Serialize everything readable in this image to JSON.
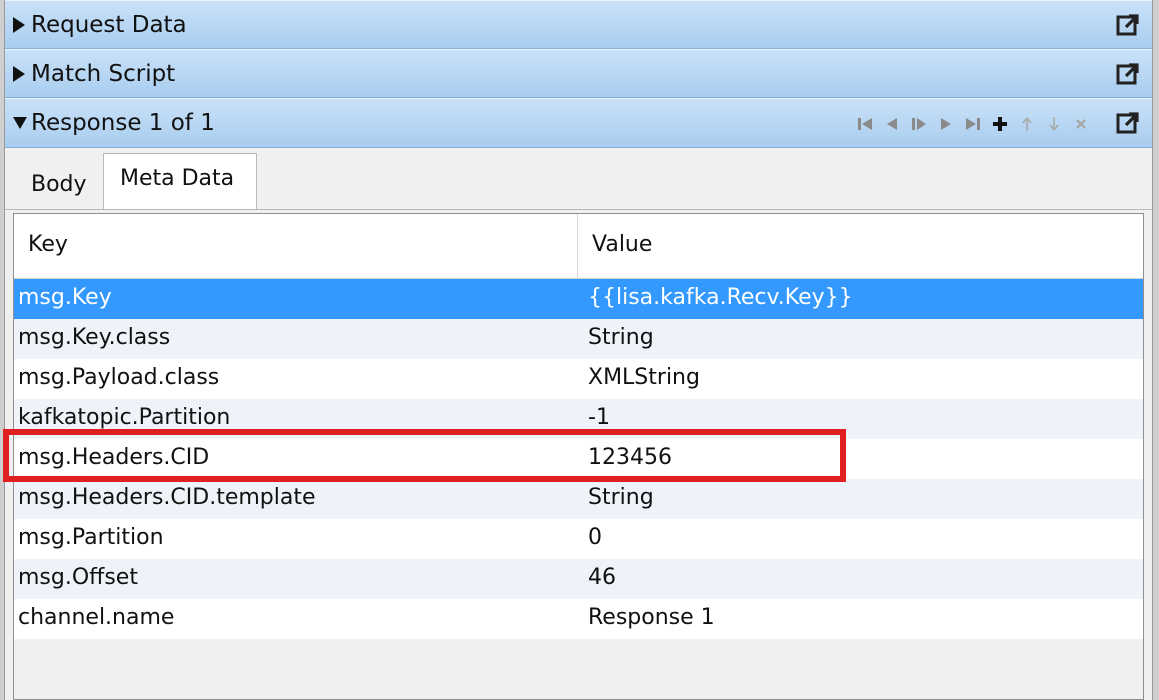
{
  "sections": {
    "request_data": {
      "label": "Request Data"
    },
    "match_script": {
      "label": "Match Script"
    },
    "response": {
      "label": "Response 1 of 1"
    }
  },
  "tabs": [
    {
      "label": "Body",
      "selected": false
    },
    {
      "label": "Meta Data",
      "selected": true
    }
  ],
  "table": {
    "columns": {
      "key": "Key",
      "value": "Value"
    },
    "rows": [
      {
        "key": "msg.Key",
        "value": "{{lisa.kafka.Recv.Key}}",
        "selected": true
      },
      {
        "key": "msg.Key.class",
        "value": "String"
      },
      {
        "key": "msg.Payload.class",
        "value": "XMLString"
      },
      {
        "key": "kafkatopic.Partition",
        "value": "-1"
      },
      {
        "key": "msg.Headers.CID",
        "value": "123456",
        "highlighted": true
      },
      {
        "key": "msg.Headers.CID.template",
        "value": "String"
      },
      {
        "key": "msg.Partition",
        "value": "0"
      },
      {
        "key": "msg.Offset",
        "value": "46"
      },
      {
        "key": "channel.name",
        "value": "Response 1"
      }
    ]
  },
  "icons": {
    "popout": "popout-icon",
    "nav": [
      "first-icon",
      "previous-icon",
      "play-icon",
      "next-icon",
      "last-icon",
      "add-icon",
      "move-up-icon",
      "move-down-icon",
      "delete-icon"
    ]
  },
  "colors": {
    "header_gradient_top": "#c9e1f8",
    "header_gradient_bottom": "#a9cdef",
    "selection": "#3399ff",
    "highlight_box": "#e02020"
  }
}
